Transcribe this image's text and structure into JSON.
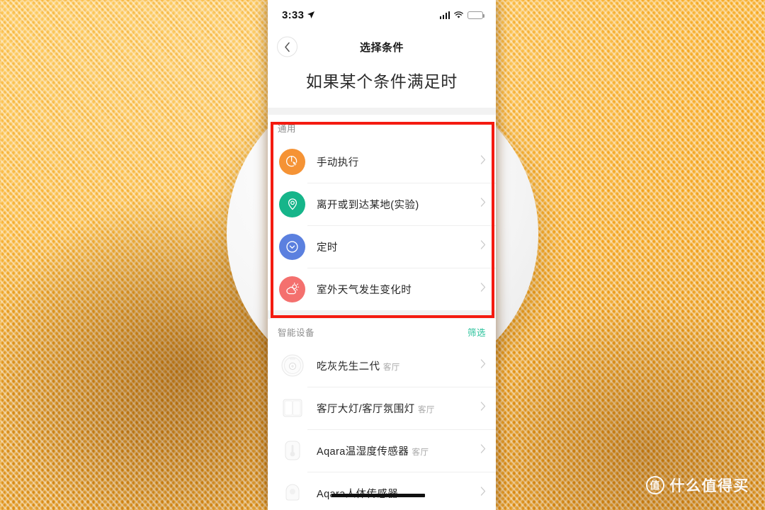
{
  "background": {
    "texture": "yellow-woven-fabric",
    "accent_yellow": "#f7a71d",
    "disc": "white-round-speaker"
  },
  "annotation": {
    "box_color": "#f41b10",
    "strikethrough_color": "#111111"
  },
  "phone": {
    "status_bar": {
      "time": "3:33",
      "location_icon": "location-arrow-icon",
      "signal_icon": "cellular-signal-icon",
      "wifi_icon": "wifi-icon",
      "battery_icon": "battery-charging-icon",
      "battery_color": "#3ad241"
    },
    "nav": {
      "back_icon": "chevron-left-icon",
      "title": "选择条件"
    },
    "heading": "如果某个条件满足时",
    "sections": [
      {
        "label": "通用",
        "action": "",
        "items": [
          {
            "title": "手动执行",
            "subtitle": "",
            "icon": "cursor-click-icon",
            "color": "#f59335"
          },
          {
            "title": "离开或到达某地(实验)",
            "subtitle": "",
            "icon": "location-pin-icon",
            "color": "#16b58a"
          },
          {
            "title": "定时",
            "subtitle": "",
            "icon": "clock-icon",
            "color": "#5b80df"
          },
          {
            "title": "室外天气发生变化时",
            "subtitle": "",
            "icon": "weather-partly-cloudy-icon",
            "color": "#f4706e"
          }
        ]
      },
      {
        "label": "智能设备",
        "action": "筛选",
        "action_color": "#27c19a",
        "items": [
          {
            "title": "吃灰先生二代",
            "subtitle": "客厅",
            "icon": "robot-vacuum-icon"
          },
          {
            "title": "客厅大灯/客厅氛围灯",
            "subtitle": "客厅",
            "icon": "wall-switch-icon"
          },
          {
            "title": "Aqara温湿度传感器",
            "subtitle": "客厅",
            "icon": "thermometer-sensor-icon"
          },
          {
            "title": "Aqara人体传感器",
            "subtitle": "",
            "icon": "motion-sensor-icon"
          }
        ]
      }
    ]
  },
  "watermark": {
    "badge": "值",
    "text": "什么值得买"
  }
}
